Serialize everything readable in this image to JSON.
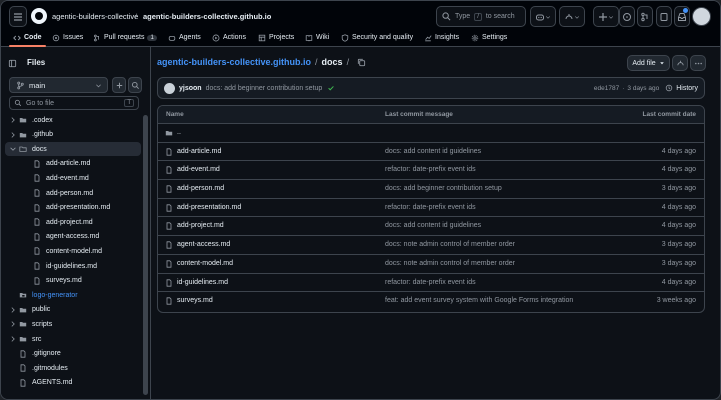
{
  "header": {
    "owner": "agentic-builders-collective",
    "separator": "/",
    "repo": "agentic-builders-collective.github.io",
    "search_pre": "Type",
    "search_key": "/",
    "search_post": "to search"
  },
  "nav": {
    "tabs": [
      {
        "label": "Code",
        "icon": "code-icon",
        "active": true
      },
      {
        "label": "Issues",
        "icon": "issue-icon"
      },
      {
        "label": "Pull requests",
        "icon": "pull-request-icon",
        "count": "1"
      },
      {
        "label": "Agents",
        "icon": "agent-icon"
      },
      {
        "label": "Actions",
        "icon": "play-icon"
      },
      {
        "label": "Projects",
        "icon": "table-icon"
      },
      {
        "label": "Wiki",
        "icon": "book-icon"
      },
      {
        "label": "Security and quality",
        "icon": "shield-icon"
      },
      {
        "label": "Insights",
        "icon": "graph-icon"
      },
      {
        "label": "Settings",
        "icon": "gear-icon"
      }
    ]
  },
  "sidebar": {
    "title": "Files",
    "branch": "main",
    "goto_placeholder": "Go to file",
    "goto_key": "T",
    "tree": [
      {
        "label": ".codex",
        "type": "folder",
        "depth": 0,
        "expanded": false
      },
      {
        "label": ".github",
        "type": "folder",
        "depth": 0,
        "expanded": false
      },
      {
        "label": "docs",
        "type": "folder",
        "depth": 0,
        "expanded": true,
        "selected": true
      },
      {
        "label": "add-article.md",
        "type": "file",
        "depth": 1
      },
      {
        "label": "add-event.md",
        "type": "file",
        "depth": 1
      },
      {
        "label": "add-person.md",
        "type": "file",
        "depth": 1
      },
      {
        "label": "add-presentation.md",
        "type": "file",
        "depth": 1
      },
      {
        "label": "add-project.md",
        "type": "file",
        "depth": 1
      },
      {
        "label": "agent-access.md",
        "type": "file",
        "depth": 1
      },
      {
        "label": "content-model.md",
        "type": "file",
        "depth": 1
      },
      {
        "label": "id-guidelines.md",
        "type": "file",
        "depth": 1
      },
      {
        "label": "surveys.md",
        "type": "file",
        "depth": 1
      },
      {
        "label": "logo-generator",
        "type": "submodule",
        "depth": 0
      },
      {
        "label": "public",
        "type": "folder",
        "depth": 0,
        "expanded": false
      },
      {
        "label": "scripts",
        "type": "folder",
        "depth": 0,
        "expanded": false
      },
      {
        "label": "src",
        "type": "folder",
        "depth": 0,
        "expanded": false
      },
      {
        "label": ".gitignore",
        "type": "file",
        "depth": 0
      },
      {
        "label": ".gitmodules",
        "type": "file",
        "depth": 0
      },
      {
        "label": "AGENTS.md",
        "type": "file",
        "depth": 0
      }
    ]
  },
  "main": {
    "path_repo": "agentic-builders-collective.github.io",
    "path_sep": "/",
    "path_dir": "docs",
    "path_sep2": "/",
    "add_file": "Add file",
    "commit": {
      "author": "yjsoon",
      "message": "docs: add beginner contribution setup",
      "hash": "ede1787",
      "dot": "·",
      "age": "3 days ago",
      "history": "History"
    },
    "columns": {
      "name": "Name",
      "message": "Last commit message",
      "date": "Last commit date"
    },
    "parent": "..",
    "files": [
      {
        "name": "add-article.md",
        "message": "docs: add content id guidelines",
        "date": "4 days ago"
      },
      {
        "name": "add-event.md",
        "message": "refactor: date-prefix event ids",
        "date": "4 days ago"
      },
      {
        "name": "add-person.md",
        "message": "docs: add beginner contribution setup",
        "date": "3 days ago"
      },
      {
        "name": "add-presentation.md",
        "message": "refactor: date-prefix event ids",
        "date": "4 days ago"
      },
      {
        "name": "add-project.md",
        "message": "docs: add content id guidelines",
        "date": "4 days ago"
      },
      {
        "name": "agent-access.md",
        "message": "docs: note admin control of member order",
        "date": "3 days ago"
      },
      {
        "name": "content-model.md",
        "message": "docs: note admin control of member order",
        "date": "3 days ago"
      },
      {
        "name": "id-guidelines.md",
        "message": "refactor: date-prefix event ids",
        "date": "4 days ago"
      },
      {
        "name": "surveys.md",
        "message": "feat: add event survey system with Google Forms integration",
        "date": "3 weeks ago"
      }
    ]
  },
  "colors": {
    "accent": "#4493f8",
    "tab_underline": "#f78166",
    "success": "#3fb950",
    "bg": "#0d1117",
    "header_bg": "#010409"
  }
}
